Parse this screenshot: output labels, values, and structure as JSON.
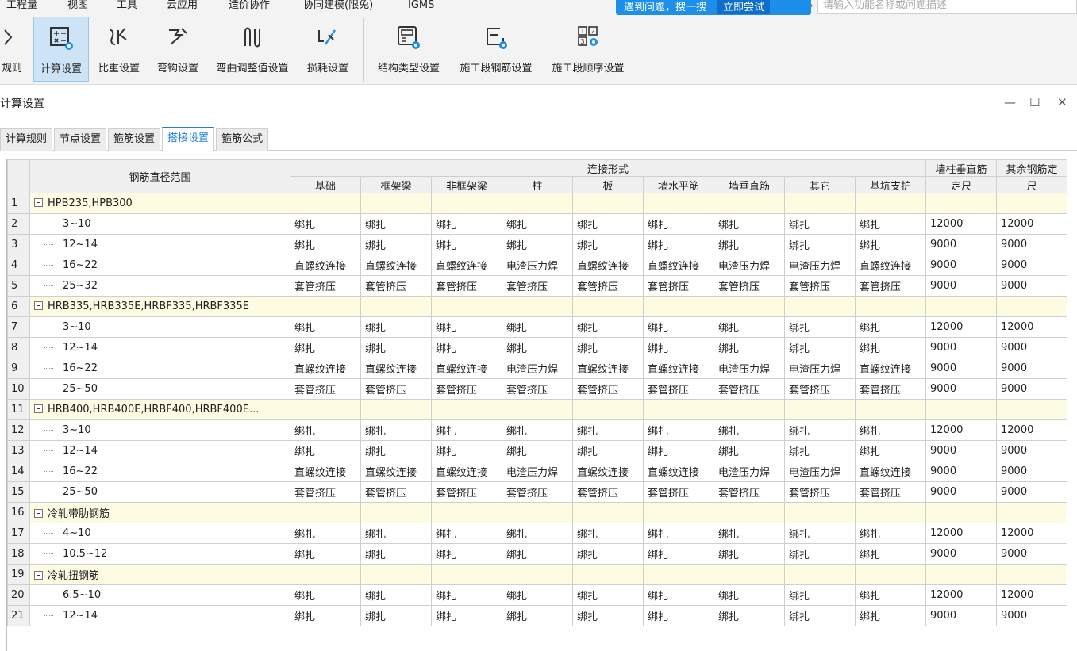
{
  "menu": [
    "工程量",
    "视图",
    "工具",
    "云应用",
    "造价协作",
    "协同建模(限免)",
    "IGMS"
  ],
  "promo": {
    "text": "遇到问题，搜一搜",
    "button": "立即尝试"
  },
  "search": {
    "placeholder": "请输入功能名称或问题描述"
  },
  "ribbon": {
    "partial_left": "规则",
    "buttons": [
      "计算设置",
      "比重设置",
      "弯钩设置",
      "弯曲调整值设置",
      "损耗设置",
      "结构类型设置",
      "施工段钢筋设置",
      "施工段顺序设置"
    ],
    "active": "计算设置"
  },
  "dialog": {
    "title": "计算设置",
    "tabs": [
      "计算规则",
      "节点设置",
      "箍筋设置",
      "搭接设置",
      "箍筋公式"
    ],
    "active_tab": "搭接设置"
  },
  "table": {
    "header_range": "钢筋直径范围",
    "header_group": "连接形式",
    "columns": [
      "基础",
      "框架梁",
      "非框架梁",
      "柱",
      "板",
      "墙水平筋",
      "墙垂直筋",
      "其它",
      "基坑支护"
    ],
    "col_wall_l1": "墙柱垂直筋",
    "col_wall_l2": "定尺",
    "col_other_l1": "其余钢筋定",
    "col_other_l2": "尺",
    "rows": [
      {
        "n": "1",
        "group": true,
        "name": "HPB235,HPB300"
      },
      {
        "n": "2",
        "name": "3~10",
        "v": [
          "绑扎",
          "绑扎",
          "绑扎",
          "绑扎",
          "绑扎",
          "绑扎",
          "绑扎",
          "绑扎",
          "绑扎",
          "12000",
          "12000"
        ]
      },
      {
        "n": "3",
        "name": "12~14",
        "v": [
          "绑扎",
          "绑扎",
          "绑扎",
          "绑扎",
          "绑扎",
          "绑扎",
          "绑扎",
          "绑扎",
          "绑扎",
          "9000",
          "9000"
        ]
      },
      {
        "n": "4",
        "name": "16~22",
        "v": [
          "直螺纹连接",
          "直螺纹连接",
          "直螺纹连接",
          "电渣压力焊",
          "直螺纹连接",
          "直螺纹连接",
          "电渣压力焊",
          "电渣压力焊",
          "直螺纹连接",
          "9000",
          "9000"
        ]
      },
      {
        "n": "5",
        "name": "25~32",
        "v": [
          "套管挤压",
          "套管挤压",
          "套管挤压",
          "套管挤压",
          "套管挤压",
          "套管挤压",
          "套管挤压",
          "套管挤压",
          "套管挤压",
          "9000",
          "9000"
        ]
      },
      {
        "n": "6",
        "group": true,
        "name": "HRB335,HRB335E,HRBF335,HRBF335E"
      },
      {
        "n": "7",
        "name": "3~10",
        "v": [
          "绑扎",
          "绑扎",
          "绑扎",
          "绑扎",
          "绑扎",
          "绑扎",
          "绑扎",
          "绑扎",
          "绑扎",
          "12000",
          "12000"
        ]
      },
      {
        "n": "8",
        "name": "12~14",
        "v": [
          "绑扎",
          "绑扎",
          "绑扎",
          "绑扎",
          "绑扎",
          "绑扎",
          "绑扎",
          "绑扎",
          "绑扎",
          "9000",
          "9000"
        ]
      },
      {
        "n": "9",
        "name": "16~22",
        "v": [
          "直螺纹连接",
          "直螺纹连接",
          "直螺纹连接",
          "电渣压力焊",
          "直螺纹连接",
          "直螺纹连接",
          "电渣压力焊",
          "电渣压力焊",
          "直螺纹连接",
          "9000",
          "9000"
        ]
      },
      {
        "n": "10",
        "name": "25~50",
        "v": [
          "套管挤压",
          "套管挤压",
          "套管挤压",
          "套管挤压",
          "套管挤压",
          "套管挤压",
          "套管挤压",
          "套管挤压",
          "套管挤压",
          "9000",
          "9000"
        ]
      },
      {
        "n": "11",
        "group": true,
        "name": "HRB400,HRB400E,HRBF400,HRBF400E..."
      },
      {
        "n": "12",
        "name": "3~10",
        "v": [
          "绑扎",
          "绑扎",
          "绑扎",
          "绑扎",
          "绑扎",
          "绑扎",
          "绑扎",
          "绑扎",
          "绑扎",
          "12000",
          "12000"
        ]
      },
      {
        "n": "13",
        "name": "12~14",
        "v": [
          "绑扎",
          "绑扎",
          "绑扎",
          "绑扎",
          "绑扎",
          "绑扎",
          "绑扎",
          "绑扎",
          "绑扎",
          "9000",
          "9000"
        ]
      },
      {
        "n": "14",
        "name": "16~22",
        "v": [
          "直螺纹连接",
          "直螺纹连接",
          "直螺纹连接",
          "电渣压力焊",
          "直螺纹连接",
          "直螺纹连接",
          "电渣压力焊",
          "电渣压力焊",
          "直螺纹连接",
          "9000",
          "9000"
        ]
      },
      {
        "n": "15",
        "name": "25~50",
        "v": [
          "套管挤压",
          "套管挤压",
          "套管挤压",
          "套管挤压",
          "套管挤压",
          "套管挤压",
          "套管挤压",
          "套管挤压",
          "套管挤压",
          "9000",
          "9000"
        ]
      },
      {
        "n": "16",
        "group": true,
        "name": "冷轧带肋钢筋"
      },
      {
        "n": "17",
        "name": "4~10",
        "v": [
          "绑扎",
          "绑扎",
          "绑扎",
          "绑扎",
          "绑扎",
          "绑扎",
          "绑扎",
          "绑扎",
          "绑扎",
          "12000",
          "12000"
        ]
      },
      {
        "n": "18",
        "name": "10.5~12",
        "v": [
          "绑扎",
          "绑扎",
          "绑扎",
          "绑扎",
          "绑扎",
          "绑扎",
          "绑扎",
          "绑扎",
          "绑扎",
          "9000",
          "9000"
        ]
      },
      {
        "n": "19",
        "group": true,
        "name": "冷轧扭钢筋"
      },
      {
        "n": "20",
        "name": "6.5~10",
        "v": [
          "绑扎",
          "绑扎",
          "绑扎",
          "绑扎",
          "绑扎",
          "绑扎",
          "绑扎",
          "绑扎",
          "绑扎",
          "12000",
          "12000"
        ]
      },
      {
        "n": "21",
        "name": "12~14",
        "v": [
          "绑扎",
          "绑扎",
          "绑扎",
          "绑扎",
          "绑扎",
          "绑扎",
          "绑扎",
          "绑扎",
          "绑扎",
          "9000",
          "9000"
        ]
      }
    ]
  },
  "colors": {
    "accent": "#1e8fe8",
    "group_row": "#fdfbe2",
    "active_ribbon": "#cde4f7"
  }
}
